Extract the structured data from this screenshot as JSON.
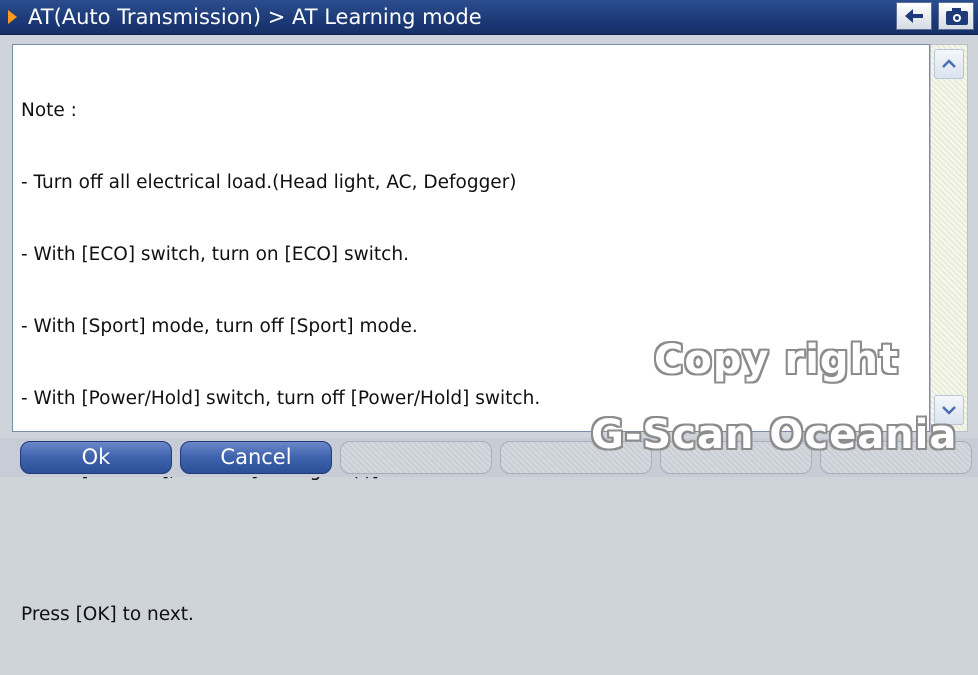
{
  "header": {
    "title": "AT(Auto Transmission) > AT Learning mode",
    "back_icon": "back-arrow-icon",
    "camera_icon": "camera-icon"
  },
  "content": {
    "lines": [
      "Note :",
      "- Turn off all electrical load.(Head light, AC, Defogger)",
      "- With [ECO] switch, turn on [ECO] switch.",
      "- With [Sport] mode, turn off [Sport] mode.",
      "- With [Power/Hold] switch, turn off [Power/Hold] switch.",
      "- With [SI-Dirve], set the [Intelligent(I)] mode.",
      "",
      "Press [OK] to next."
    ]
  },
  "watermark": {
    "line1": "Copy right",
    "line2": "G-Scan Oceania"
  },
  "footer": {
    "buttons": [
      {
        "label": "Ok"
      },
      {
        "label": "Cancel"
      },
      {
        "label": ""
      },
      {
        "label": ""
      },
      {
        "label": ""
      },
      {
        "label": ""
      }
    ]
  },
  "colors": {
    "titlebar": "#1d3b78",
    "title_arrow": "#ff9a1f",
    "button_active": "#3f62ad"
  }
}
